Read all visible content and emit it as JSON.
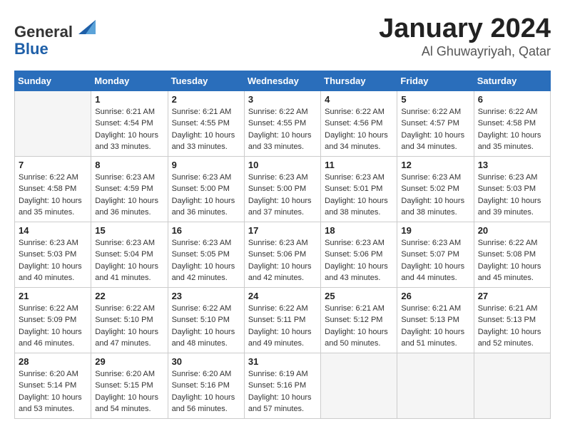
{
  "header": {
    "logo_line1": "General",
    "logo_line2": "Blue",
    "month": "January 2024",
    "location": "Al Ghuwayriyah, Qatar"
  },
  "days_of_week": [
    "Sunday",
    "Monday",
    "Tuesday",
    "Wednesday",
    "Thursday",
    "Friday",
    "Saturday"
  ],
  "weeks": [
    [
      {
        "day": "",
        "info": ""
      },
      {
        "day": "1",
        "info": "Sunrise: 6:21 AM\nSunset: 4:54 PM\nDaylight: 10 hours\nand 33 minutes."
      },
      {
        "day": "2",
        "info": "Sunrise: 6:21 AM\nSunset: 4:55 PM\nDaylight: 10 hours\nand 33 minutes."
      },
      {
        "day": "3",
        "info": "Sunrise: 6:22 AM\nSunset: 4:55 PM\nDaylight: 10 hours\nand 33 minutes."
      },
      {
        "day": "4",
        "info": "Sunrise: 6:22 AM\nSunset: 4:56 PM\nDaylight: 10 hours\nand 34 minutes."
      },
      {
        "day": "5",
        "info": "Sunrise: 6:22 AM\nSunset: 4:57 PM\nDaylight: 10 hours\nand 34 minutes."
      },
      {
        "day": "6",
        "info": "Sunrise: 6:22 AM\nSunset: 4:58 PM\nDaylight: 10 hours\nand 35 minutes."
      }
    ],
    [
      {
        "day": "7",
        "info": "Sunrise: 6:22 AM\nSunset: 4:58 PM\nDaylight: 10 hours\nand 35 minutes."
      },
      {
        "day": "8",
        "info": "Sunrise: 6:23 AM\nSunset: 4:59 PM\nDaylight: 10 hours\nand 36 minutes."
      },
      {
        "day": "9",
        "info": "Sunrise: 6:23 AM\nSunset: 5:00 PM\nDaylight: 10 hours\nand 36 minutes."
      },
      {
        "day": "10",
        "info": "Sunrise: 6:23 AM\nSunset: 5:00 PM\nDaylight: 10 hours\nand 37 minutes."
      },
      {
        "day": "11",
        "info": "Sunrise: 6:23 AM\nSunset: 5:01 PM\nDaylight: 10 hours\nand 38 minutes."
      },
      {
        "day": "12",
        "info": "Sunrise: 6:23 AM\nSunset: 5:02 PM\nDaylight: 10 hours\nand 38 minutes."
      },
      {
        "day": "13",
        "info": "Sunrise: 6:23 AM\nSunset: 5:03 PM\nDaylight: 10 hours\nand 39 minutes."
      }
    ],
    [
      {
        "day": "14",
        "info": "Sunrise: 6:23 AM\nSunset: 5:03 PM\nDaylight: 10 hours\nand 40 minutes."
      },
      {
        "day": "15",
        "info": "Sunrise: 6:23 AM\nSunset: 5:04 PM\nDaylight: 10 hours\nand 41 minutes."
      },
      {
        "day": "16",
        "info": "Sunrise: 6:23 AM\nSunset: 5:05 PM\nDaylight: 10 hours\nand 42 minutes."
      },
      {
        "day": "17",
        "info": "Sunrise: 6:23 AM\nSunset: 5:06 PM\nDaylight: 10 hours\nand 42 minutes."
      },
      {
        "day": "18",
        "info": "Sunrise: 6:23 AM\nSunset: 5:06 PM\nDaylight: 10 hours\nand 43 minutes."
      },
      {
        "day": "19",
        "info": "Sunrise: 6:23 AM\nSunset: 5:07 PM\nDaylight: 10 hours\nand 44 minutes."
      },
      {
        "day": "20",
        "info": "Sunrise: 6:22 AM\nSunset: 5:08 PM\nDaylight: 10 hours\nand 45 minutes."
      }
    ],
    [
      {
        "day": "21",
        "info": "Sunrise: 6:22 AM\nSunset: 5:09 PM\nDaylight: 10 hours\nand 46 minutes."
      },
      {
        "day": "22",
        "info": "Sunrise: 6:22 AM\nSunset: 5:10 PM\nDaylight: 10 hours\nand 47 minutes."
      },
      {
        "day": "23",
        "info": "Sunrise: 6:22 AM\nSunset: 5:10 PM\nDaylight: 10 hours\nand 48 minutes."
      },
      {
        "day": "24",
        "info": "Sunrise: 6:22 AM\nSunset: 5:11 PM\nDaylight: 10 hours\nand 49 minutes."
      },
      {
        "day": "25",
        "info": "Sunrise: 6:21 AM\nSunset: 5:12 PM\nDaylight: 10 hours\nand 50 minutes."
      },
      {
        "day": "26",
        "info": "Sunrise: 6:21 AM\nSunset: 5:13 PM\nDaylight: 10 hours\nand 51 minutes."
      },
      {
        "day": "27",
        "info": "Sunrise: 6:21 AM\nSunset: 5:13 PM\nDaylight: 10 hours\nand 52 minutes."
      }
    ],
    [
      {
        "day": "28",
        "info": "Sunrise: 6:20 AM\nSunset: 5:14 PM\nDaylight: 10 hours\nand 53 minutes."
      },
      {
        "day": "29",
        "info": "Sunrise: 6:20 AM\nSunset: 5:15 PM\nDaylight: 10 hours\nand 54 minutes."
      },
      {
        "day": "30",
        "info": "Sunrise: 6:20 AM\nSunset: 5:16 PM\nDaylight: 10 hours\nand 56 minutes."
      },
      {
        "day": "31",
        "info": "Sunrise: 6:19 AM\nSunset: 5:16 PM\nDaylight: 10 hours\nand 57 minutes."
      },
      {
        "day": "",
        "info": ""
      },
      {
        "day": "",
        "info": ""
      },
      {
        "day": "",
        "info": ""
      }
    ]
  ]
}
